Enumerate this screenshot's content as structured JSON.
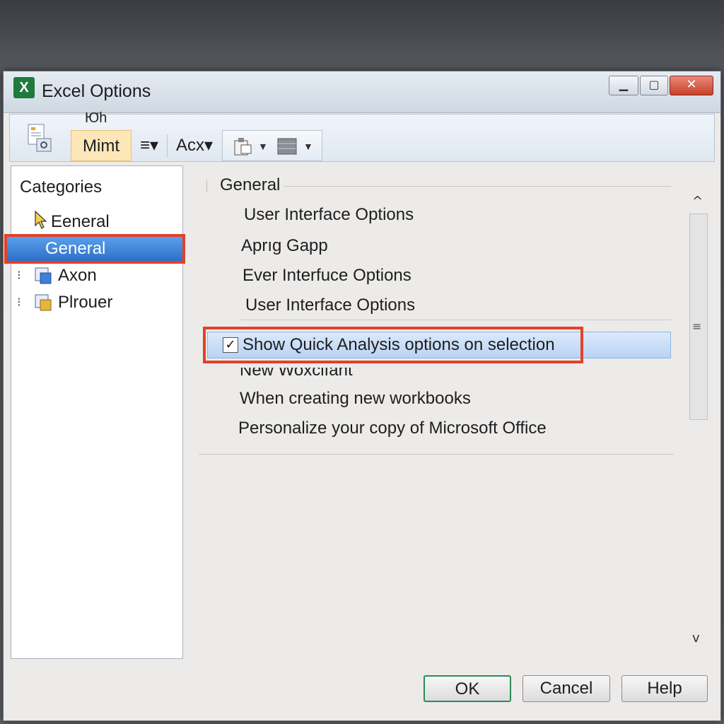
{
  "window": {
    "title": "Excel Options",
    "app_icon": "X",
    "controls": {
      "minimize": "▁",
      "maximize": "▢",
      "close": "✕"
    }
  },
  "toolbar": {
    "top_label": "Ю̈h",
    "items": [
      {
        "label": "Mimt",
        "active": true
      },
      {
        "label": "≡▾"
      },
      {
        "label": "Acx▾"
      }
    ],
    "group_icons": [
      "paste-icon",
      "layout-icon"
    ]
  },
  "sidebar": {
    "heading": "Categories",
    "items": [
      {
        "label": "Eeneral",
        "icon": "cursor-arrow-icon"
      },
      {
        "label": "General",
        "selected": true
      },
      {
        "label": "Axon",
        "icon": "tree-node-icon"
      },
      {
        "label": "Plrouer",
        "icon": "tree-node-icon"
      }
    ]
  },
  "content": {
    "section_title": "General",
    "options": [
      "User Interface Options",
      "Aprıg Gapp",
      "Ever Interfuce Options",
      "User Interface Options"
    ],
    "quick_analysis": {
      "label": "Show Quick Analysis options on selection",
      "checked": true,
      "check_glyph": "✓"
    },
    "below_options": [
      "New Woxclfant",
      "When creating new workbooks",
      "Personalize your copy of Microsoft Office"
    ]
  },
  "scrollbar": {
    "up": "^",
    "down": "v",
    "grip": "≡"
  },
  "footer": {
    "ok": "OK",
    "cancel": "Cancel",
    "help": "Help"
  },
  "colors": {
    "highlight_red": "#e3412a",
    "selection_blue": "#2d6fc9",
    "ok_border": "#2e8b57"
  }
}
